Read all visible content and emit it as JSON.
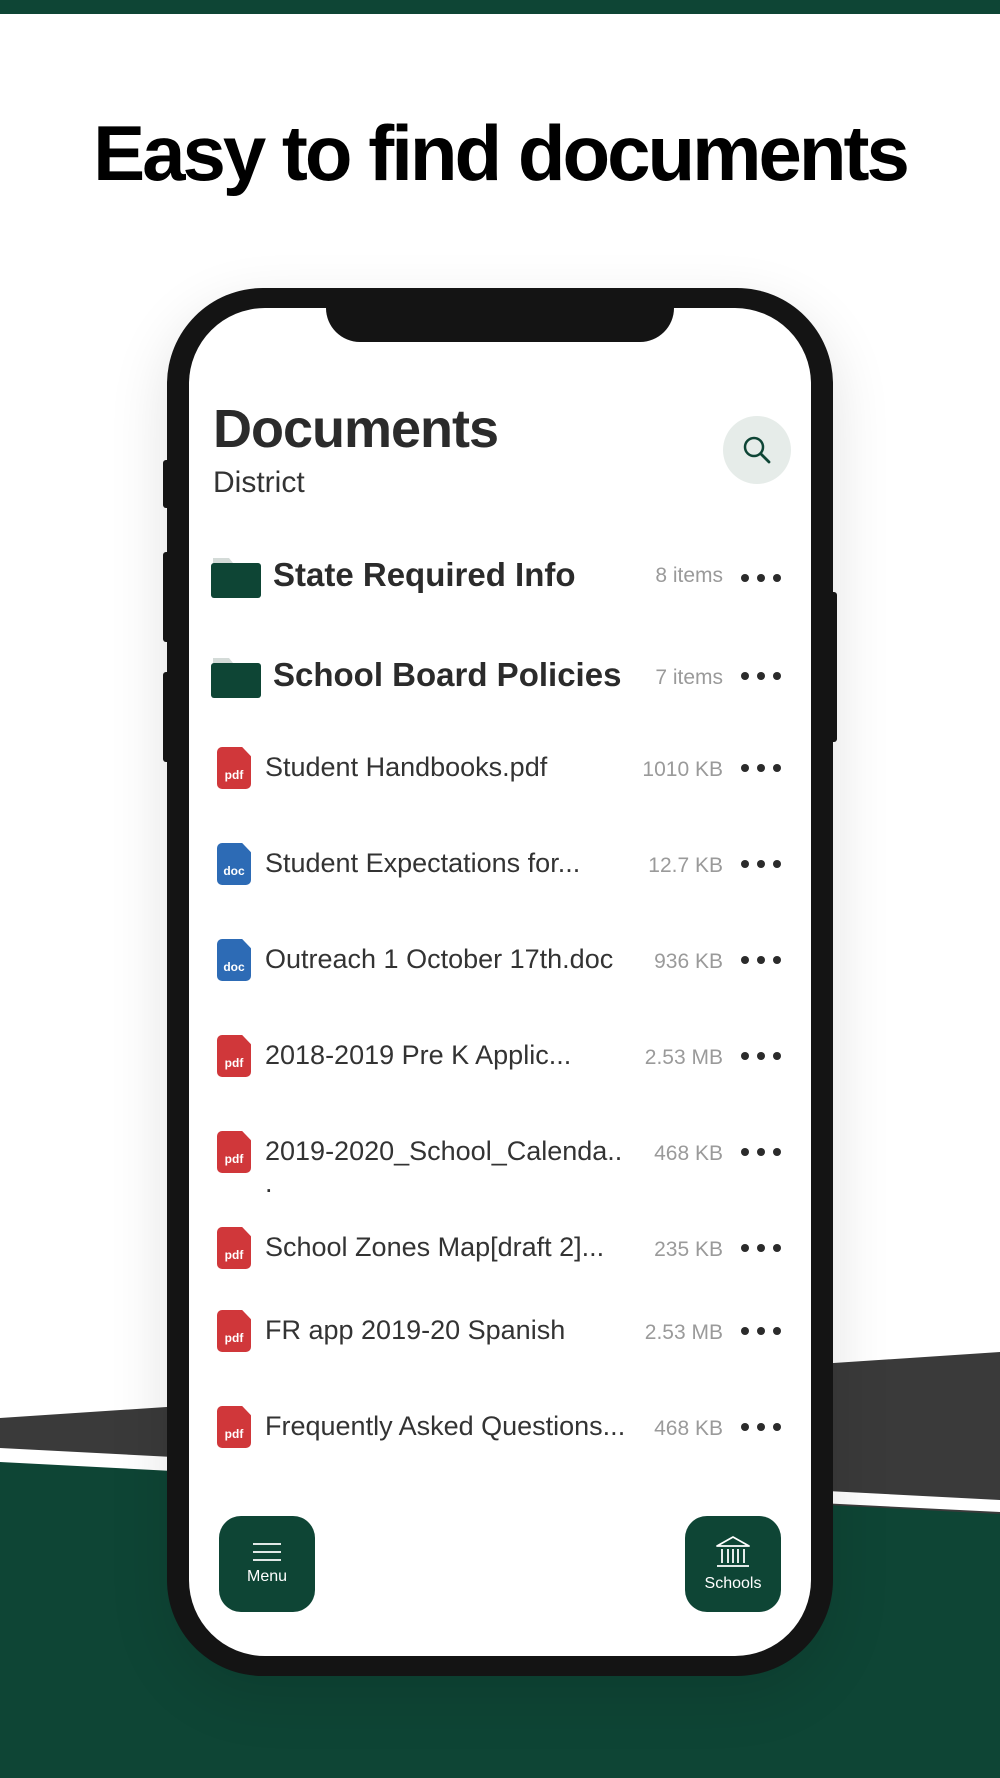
{
  "headline": "Easy to find documents",
  "colors": {
    "brand_green": "#0e4535",
    "pdf_red": "#d0373a",
    "doc_blue": "#2d6bb5"
  },
  "screen": {
    "title": "Documents",
    "subtitle": "District",
    "search_icon": "search-icon",
    "folders": [
      {
        "name": "State Required Info",
        "count": "8 items"
      },
      {
        "name": "School Board Policies",
        "count": "7 items"
      }
    ],
    "files": [
      {
        "name": "Student Handbooks.pdf",
        "type": "pdf",
        "size": "1010 KB"
      },
      {
        "name": "Student Expectations for...",
        "type": "doc",
        "size": "12.7 KB"
      },
      {
        "name": "Outreach 1 October 17th.doc",
        "type": "doc",
        "size": "936 KB"
      },
      {
        "name": "2018-2019 Pre K Applic...",
        "type": "pdf",
        "size": "2.53 MB"
      },
      {
        "name": "2019-2020_School_Calenda..",
        "name_cont": ".",
        "type": "pdf",
        "size": "468 KB"
      },
      {
        "name": "School Zones Map[draft 2]...",
        "type": "pdf",
        "size": "235 KB"
      },
      {
        "name": "FR app 2019-20 Spanish",
        "type": "pdf",
        "size": "2.53 MB"
      },
      {
        "name": "Frequently Asked Questions...",
        "type": "pdf",
        "size": "468 KB"
      }
    ],
    "nav": {
      "menu_label": "Menu",
      "schools_label": "Schools"
    }
  }
}
